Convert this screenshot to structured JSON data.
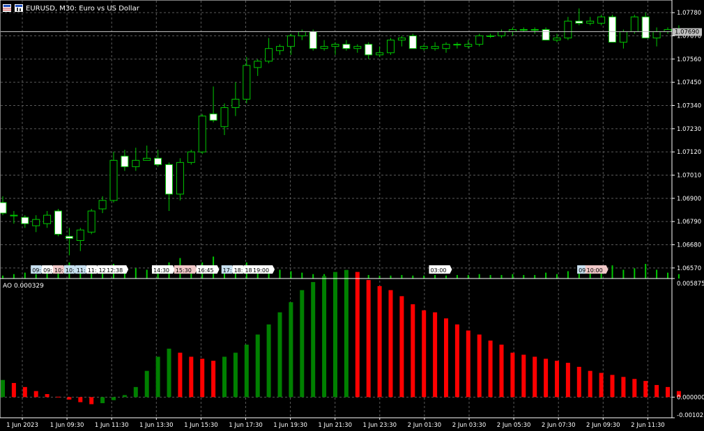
{
  "window": {
    "title": "EURUSD, M30:  Euro vs US Dollar",
    "current_price_label": "1.07690",
    "indicator_label": "AO 0.000329"
  },
  "colors": {
    "background": "#000000",
    "grid": "#5a5a5a",
    "axis": "#ffffff",
    "candle_outline": "#00c800",
    "bull_body": "#000000",
    "bear_body": "#ffffff",
    "volume": "#00c800",
    "ao_up": "#008000",
    "ao_down": "#ff0000",
    "price_line": "#c0c0c0",
    "event_neutral": "#ffffff",
    "event_low": "#c8e0f0",
    "event_high": "#f0c8c8"
  },
  "chart_data": [
    {
      "type": "candlestick",
      "symbol": "EURUSD",
      "timeframe": "M30",
      "ylim": [
        1.0652,
        1.0784
      ],
      "y_ticks": [
        "1.07780",
        "1.07670",
        "1.07560",
        "1.07450",
        "1.07340",
        "1.07230",
        "1.07120",
        "1.07010",
        "1.06900",
        "1.06790",
        "1.06680",
        "1.06570"
      ],
      "current_price": 1.0769,
      "x_tick_labels": [
        "1 Jun 2023",
        "1 Jun 09:30",
        "1 Jun 11:30",
        "1 Jun 13:30",
        "1 Jun 15:30",
        "1 Jun 17:30",
        "1 Jun 19:30",
        "1 Jun 21:30",
        "1 Jun 23:30",
        "2 Jun 01:30",
        "2 Jun 03:30",
        "2 Jun 05:30",
        "2 Jun 07:30",
        "2 Jun 09:30",
        "2 Jun 11:30"
      ],
      "candles": [
        {
          "o": 1.0688,
          "h": 1.0691,
          "l": 1.0682,
          "c": 1.0683
        },
        {
          "o": 1.0682,
          "h": 1.0684,
          "l": 1.0678,
          "c": 1.0682
        },
        {
          "o": 1.0681,
          "h": 1.0682,
          "l": 1.0676,
          "c": 1.0678
        },
        {
          "o": 1.0677,
          "h": 1.0682,
          "l": 1.0674,
          "c": 1.068
        },
        {
          "o": 1.0678,
          "h": 1.0684,
          "l": 1.0676,
          "c": 1.0682
        },
        {
          "o": 1.0684,
          "h": 1.0685,
          "l": 1.0672,
          "c": 1.0673
        },
        {
          "o": 1.0672,
          "h": 1.0676,
          "l": 1.0663,
          "c": 1.0671
        },
        {
          "o": 1.067,
          "h": 1.0676,
          "l": 1.0665,
          "c": 1.0675
        },
        {
          "o": 1.0674,
          "h": 1.0685,
          "l": 1.0673,
          "c": 1.0684
        },
        {
          "o": 1.0685,
          "h": 1.0691,
          "l": 1.0683,
          "c": 1.0689
        },
        {
          "o": 1.0689,
          "h": 1.0712,
          "l": 1.0688,
          "c": 1.0708
        },
        {
          "o": 1.071,
          "h": 1.0713,
          "l": 1.0703,
          "c": 1.0705
        },
        {
          "o": 1.0705,
          "h": 1.0714,
          "l": 1.0703,
          "c": 1.0708
        },
        {
          "o": 1.0708,
          "h": 1.0715,
          "l": 1.0708,
          "c": 1.0709
        },
        {
          "o": 1.0709,
          "h": 1.0713,
          "l": 1.0705,
          "c": 1.0706
        },
        {
          "o": 1.0706,
          "h": 1.0707,
          "l": 1.0684,
          "c": 1.0692
        },
        {
          "o": 1.0692,
          "h": 1.0709,
          "l": 1.0689,
          "c": 1.0707
        },
        {
          "o": 1.0707,
          "h": 1.0713,
          "l": 1.0706,
          "c": 1.0712
        },
        {
          "o": 1.0712,
          "h": 1.073,
          "l": 1.0711,
          "c": 1.0729
        },
        {
          "o": 1.073,
          "h": 1.0743,
          "l": 1.0726,
          "c": 1.0727
        },
        {
          "o": 1.0724,
          "h": 1.0735,
          "l": 1.072,
          "c": 1.0733
        },
        {
          "o": 1.0733,
          "h": 1.0745,
          "l": 1.0729,
          "c": 1.0737
        },
        {
          "o": 1.0737,
          "h": 1.0757,
          "l": 1.0735,
          "c": 1.0753
        },
        {
          "o": 1.0752,
          "h": 1.0756,
          "l": 1.0748,
          "c": 1.0755
        },
        {
          "o": 1.0755,
          "h": 1.0766,
          "l": 1.0754,
          "c": 1.0761
        },
        {
          "o": 1.076,
          "h": 1.0763,
          "l": 1.0758,
          "c": 1.0762
        },
        {
          "o": 1.0762,
          "h": 1.0768,
          "l": 1.0758,
          "c": 1.0767
        },
        {
          "o": 1.0767,
          "h": 1.077,
          "l": 1.0765,
          "c": 1.0769
        },
        {
          "o": 1.0769,
          "h": 1.077,
          "l": 1.076,
          "c": 1.0761
        },
        {
          "o": 1.0761,
          "h": 1.0765,
          "l": 1.076,
          "c": 1.0762
        },
        {
          "o": 1.0762,
          "h": 1.0764,
          "l": 1.0758,
          "c": 1.0763
        },
        {
          "o": 1.0763,
          "h": 1.0765,
          "l": 1.076,
          "c": 1.0761
        },
        {
          "o": 1.0761,
          "h": 1.0763,
          "l": 1.0759,
          "c": 1.0762
        },
        {
          "o": 1.0763,
          "h": 1.0764,
          "l": 1.0756,
          "c": 1.0758
        },
        {
          "o": 1.0758,
          "h": 1.0762,
          "l": 1.0757,
          "c": 1.0759
        },
        {
          "o": 1.0759,
          "h": 1.0766,
          "l": 1.0758,
          "c": 1.0765
        },
        {
          "o": 1.0765,
          "h": 1.0767,
          "l": 1.0762,
          "c": 1.0766
        },
        {
          "o": 1.0767,
          "h": 1.0768,
          "l": 1.0761,
          "c": 1.0761
        },
        {
          "o": 1.0761,
          "h": 1.0763,
          "l": 1.076,
          "c": 1.0762
        },
        {
          "o": 1.0761,
          "h": 1.0764,
          "l": 1.076,
          "c": 1.0762
        },
        {
          "o": 1.0761,
          "h": 1.0764,
          "l": 1.0759,
          "c": 1.0763
        },
        {
          "o": 1.0763,
          "h": 1.0764,
          "l": 1.0761,
          "c": 1.0763
        },
        {
          "o": 1.0762,
          "h": 1.0765,
          "l": 1.0761,
          "c": 1.0763
        },
        {
          "o": 1.0763,
          "h": 1.0768,
          "l": 1.0762,
          "c": 1.0767
        },
        {
          "o": 1.0767,
          "h": 1.0768,
          "l": 1.0766,
          "c": 1.0767
        },
        {
          "o": 1.0767,
          "h": 1.077,
          "l": 1.0766,
          "c": 1.0769
        },
        {
          "o": 1.0769,
          "h": 1.0771,
          "l": 1.0767,
          "c": 1.077
        },
        {
          "o": 1.077,
          "h": 1.0771,
          "l": 1.0769,
          "c": 1.077
        },
        {
          "o": 1.077,
          "h": 1.0771,
          "l": 1.0768,
          "c": 1.077
        },
        {
          "o": 1.077,
          "h": 1.0771,
          "l": 1.0765,
          "c": 1.0765
        },
        {
          "o": 1.0765,
          "h": 1.0768,
          "l": 1.0764,
          "c": 1.0766
        },
        {
          "o": 1.0766,
          "h": 1.0776,
          "l": 1.0765,
          "c": 1.0774
        },
        {
          "o": 1.0774,
          "h": 1.078,
          "l": 1.0772,
          "c": 1.0773
        },
        {
          "o": 1.0773,
          "h": 1.0776,
          "l": 1.0772,
          "c": 1.0774
        },
        {
          "o": 1.0773,
          "h": 1.0777,
          "l": 1.0772,
          "c": 1.0776
        },
        {
          "o": 1.0776,
          "h": 1.0777,
          "l": 1.0764,
          "c": 1.0764
        },
        {
          "o": 1.0764,
          "h": 1.077,
          "l": 1.0761,
          "c": 1.0769
        },
        {
          "o": 1.0769,
          "h": 1.0777,
          "l": 1.0768,
          "c": 1.0776
        },
        {
          "o": 1.0776,
          "h": 1.0778,
          "l": 1.0766,
          "c": 1.0766
        },
        {
          "o": 1.0766,
          "h": 1.0771,
          "l": 1.0762,
          "c": 1.0769
        },
        {
          "o": 1.0769,
          "h": 1.0771,
          "l": 1.0768,
          "c": 1.077
        },
        {
          "o": 1.077,
          "h": 1.0772,
          "l": 1.0769,
          "c": 1.077
        }
      ],
      "volume_levels": [
        0.1,
        0.15,
        0.2,
        0.15,
        0.2,
        0.35,
        0.55,
        0.3,
        0.25,
        0.3,
        0.5,
        0.3,
        0.35,
        0.3,
        0.3,
        0.55,
        0.7,
        0.4,
        0.55,
        0.75,
        0.4,
        0.35,
        0.55,
        0.35,
        0.4,
        0.3,
        0.25,
        0.2,
        0.15,
        0.15,
        0.12,
        0.12,
        0.15,
        0.12,
        0.1,
        0.1,
        0.12,
        0.1,
        0.1,
        0.12,
        0.1,
        0.12,
        0.12,
        0.15,
        0.12,
        0.12,
        0.15,
        0.12,
        0.12,
        0.2,
        0.15,
        0.25,
        0.3,
        0.2,
        0.25,
        0.45,
        0.3,
        0.35,
        0.5,
        0.3,
        0.2,
        0.15
      ],
      "events": [
        {
          "label": "09:",
          "bg": "event_low",
          "at": 3
        },
        {
          "label": "09:",
          "bg": "event_neutral",
          "at": 4
        },
        {
          "label": "10:",
          "bg": "event_high",
          "at": 5
        },
        {
          "label": "10:",
          "bg": "event_low",
          "at": 6
        },
        {
          "label": "11:",
          "bg": "event_low",
          "at": 7
        },
        {
          "label": "11:",
          "bg": "event_neutral",
          "at": 8
        },
        {
          "label": "12:",
          "bg": "event_neutral",
          "at": 9
        },
        {
          "label": "12:38",
          "bg": "event_neutral",
          "at": 10.2
        },
        {
          "label": "14:30",
          "bg": "event_neutral",
          "at": 14.4
        },
        {
          "label": "15:30",
          "bg": "event_high",
          "at": 16.4
        },
        {
          "label": "16:45",
          "bg": "event_neutral",
          "at": 18.4
        },
        {
          "label": "17:",
          "bg": "event_low",
          "at": 20.2
        },
        {
          "label": "18:",
          "bg": "event_neutral",
          "at": 21.2
        },
        {
          "label": "18:",
          "bg": "event_neutral",
          "at": 22.2
        },
        {
          "label": "19:00",
          "bg": "event_neutral",
          "at": 23.4
        },
        {
          "label": "03:00",
          "bg": "event_neutral",
          "at": 39.4
        },
        {
          "label": "09:",
          "bg": "event_low",
          "at": 52.3
        },
        {
          "label": "10:00",
          "bg": "event_high",
          "at": 53.5
        }
      ]
    },
    {
      "type": "bar",
      "name": "AO",
      "ylim": [
        -0.001023,
        0.005875
      ],
      "y_ticks": [
        "0.005875",
        "0.000000",
        "-0.001023"
      ],
      "values": [
        0.00085,
        0.0007,
        0.0005,
        0.0003,
        0.00015,
        2e-05,
        -0.00012,
        -0.00025,
        -0.00035,
        -0.0003,
        -0.00015,
        0.0001,
        0.0005,
        0.0013,
        0.002,
        0.0024,
        0.0022,
        0.002,
        0.0019,
        0.0018,
        0.002,
        0.0022,
        0.0026,
        0.0031,
        0.0036,
        0.0042,
        0.0047,
        0.0053,
        0.0057,
        0.006,
        0.0062,
        0.0063,
        0.0062,
        0.0058,
        0.0055,
        0.0053,
        0.005,
        0.0046,
        0.0043,
        0.0042,
        0.0039,
        0.0036,
        0.0033,
        0.0031,
        0.0028,
        0.0026,
        0.0022,
        0.0021,
        0.002,
        0.0019,
        0.0018,
        0.0017,
        0.0015,
        0.0013,
        0.0012,
        0.0011,
        0.001,
        0.0009,
        0.0008,
        0.0006,
        0.0005,
        0.0003
      ]
    }
  ]
}
